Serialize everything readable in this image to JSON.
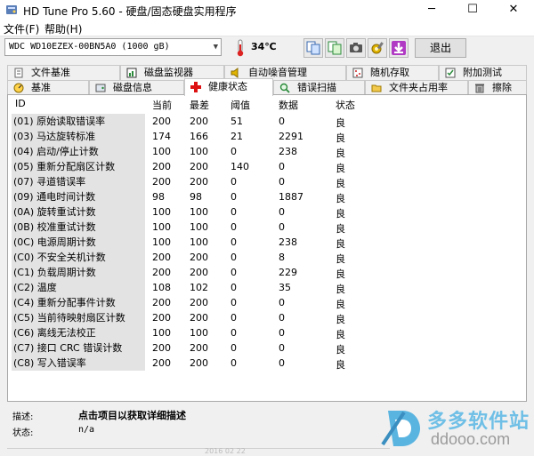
{
  "window": {
    "title": "HD Tune Pro 5.60 - 硬盘/固态硬盘实用程序",
    "minimize": "─",
    "maximize": "☐",
    "close": "✕"
  },
  "menu": {
    "file": "文件(F)",
    "help": "帮助(H)"
  },
  "toolbar": {
    "drive": "WDC WD10EZEX-00BN5A0 (1000 gB)",
    "temperature": "34℃",
    "exit_label": "退出"
  },
  "tabs_top": [
    "文件基准",
    "磁盘监视器",
    "自动噪音管理",
    "随机存取",
    "附加测试"
  ],
  "tabs_bottom": [
    "基准",
    "磁盘信息",
    "健康状态",
    "错误扫描",
    "文件夹占用率",
    "擦除"
  ],
  "table": {
    "headers": [
      "ID",
      "当前",
      "最差",
      "阈值",
      "数据",
      "状态"
    ],
    "rows": [
      [
        "(01) 原始读取错误率",
        "200",
        "200",
        "51",
        "0",
        "良"
      ],
      [
        "(03) 马达旋转标准",
        "174",
        "166",
        "21",
        "2291",
        "良"
      ],
      [
        "(04) 启动/停止计数",
        "100",
        "100",
        "0",
        "238",
        "良"
      ],
      [
        "(05) 重新分配扇区计数",
        "200",
        "200",
        "140",
        "0",
        "良"
      ],
      [
        "(07) 寻道错误率",
        "200",
        "200",
        "0",
        "0",
        "良"
      ],
      [
        "(09) 通电时间计数",
        "98",
        "98",
        "0",
        "1887",
        "良"
      ],
      [
        "(0A) 旋转重试计数",
        "100",
        "100",
        "0",
        "0",
        "良"
      ],
      [
        "(0B) 校准重试计数",
        "100",
        "100",
        "0",
        "0",
        "良"
      ],
      [
        "(0C) 电源周期计数",
        "100",
        "100",
        "0",
        "238",
        "良"
      ],
      [
        "(C0) 不安全关机计数",
        "200",
        "200",
        "0",
        "8",
        "良"
      ],
      [
        "(C1) 负载周期计数",
        "200",
        "200",
        "0",
        "229",
        "良"
      ],
      [
        "(C2) 温度",
        "108",
        "102",
        "0",
        "35",
        "良"
      ],
      [
        "(C4) 重新分配事件计数",
        "200",
        "200",
        "0",
        "0",
        "良"
      ],
      [
        "(C5) 当前待映射扇区计数",
        "200",
        "200",
        "0",
        "0",
        "良"
      ],
      [
        "(C6) 离线无法校正",
        "100",
        "100",
        "0",
        "0",
        "良"
      ],
      [
        "(C7) 接口 CRC 错误计数",
        "200",
        "200",
        "0",
        "0",
        "良"
      ],
      [
        "(C8) 写入错误率",
        "200",
        "200",
        "0",
        "0",
        "良"
      ]
    ]
  },
  "description": {
    "label": "描述:",
    "value": "点击项目以获取详细描述"
  },
  "status": {
    "label": "状态:",
    "value": "n/a"
  },
  "watermark": {
    "cn": "多多软件站",
    "url": "ddooo.com"
  },
  "bottom_text": "2016 02 22"
}
